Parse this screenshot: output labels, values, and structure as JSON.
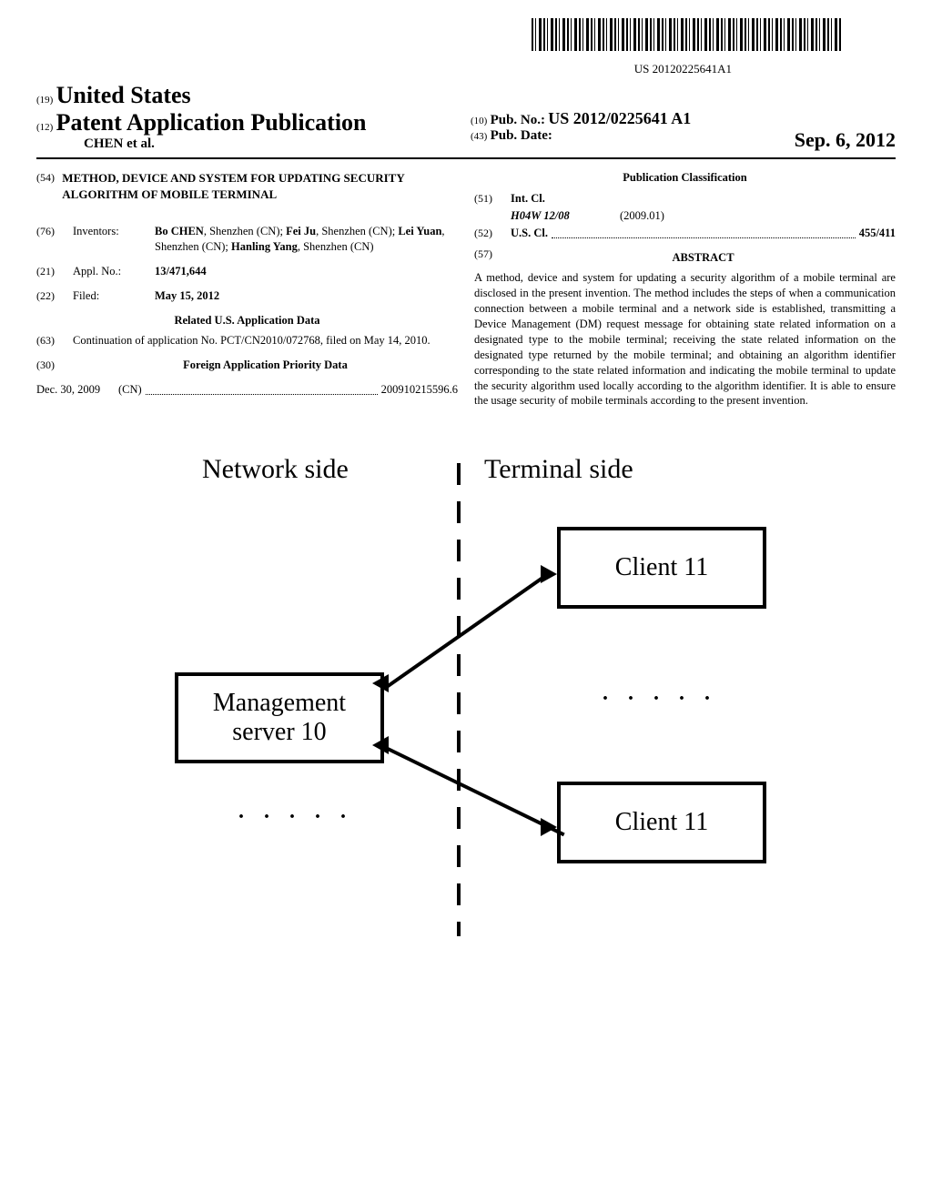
{
  "barcode_label": "US 20120225641A1",
  "header": {
    "code19": "(19)",
    "country": "United States",
    "code12": "(12)",
    "pap": "Patent Application Publication",
    "authors_line": "CHEN et al.",
    "code10": "(10)",
    "pub_no_label": "Pub. No.:",
    "pub_no_value": "US 2012/0225641 A1",
    "code43": "(43)",
    "pub_date_label": "Pub. Date:",
    "pub_date_value": "Sep. 6, 2012"
  },
  "left_col": {
    "code54": "(54)",
    "title": "METHOD, DEVICE AND SYSTEM FOR UPDATING SECURITY ALGORITHM OF MOBILE TERMINAL",
    "code76": "(76)",
    "inventors_label": "Inventors:",
    "inventors_value": "Bo CHEN, Shenzhen (CN); Fei Ju, Shenzhen (CN); Lei Yuan, Shenzhen (CN); Hanling Yang, Shenzhen (CN)",
    "code21": "(21)",
    "appl_no_label": "Appl. No.:",
    "appl_no_value": "13/471,644",
    "code22": "(22)",
    "filed_label": "Filed:",
    "filed_value": "May 15, 2012",
    "related_heading": "Related U.S. Application Data",
    "code63": "(63)",
    "continuation": "Continuation of application No. PCT/CN2010/072768, filed on May 14, 2010.",
    "code30": "(30)",
    "foreign_heading": "Foreign Application Priority Data",
    "foreign_date": "Dec. 30, 2009",
    "foreign_country": "(CN)",
    "foreign_number": "200910215596.6"
  },
  "right_col": {
    "pub_class_heading": "Publication Classification",
    "code51": "(51)",
    "int_cl_label": "Int. Cl.",
    "int_cl_code": "H04W 12/08",
    "int_cl_year": "(2009.01)",
    "code52": "(52)",
    "us_cl_label": "U.S. Cl.",
    "us_cl_value": "455/411",
    "code57": "(57)",
    "abstract_label": "ABSTRACT",
    "abstract_text": "A method, device and system for updating a security algorithm of a mobile terminal are disclosed in the present invention. The method includes the steps of when a communication connection between a mobile terminal and a network side is established, transmitting a Device Management (DM) request message for obtaining state related information on a designated type to the mobile terminal; receiving the state related information on the designated type returned by the mobile terminal; and obtaining an algorithm identifier corresponding to the state related information and indicating the mobile terminal to update the security algorithm used locally according to the algorithm identifier. It is able to ensure the usage security of mobile terminals according to the present invention."
  },
  "diagram": {
    "network_label": "Network side",
    "terminal_label": "Terminal side",
    "server_box": "Management\nserver 10",
    "client1": "Client 11",
    "client2": "Client 11",
    "dots": ". . . . ."
  }
}
